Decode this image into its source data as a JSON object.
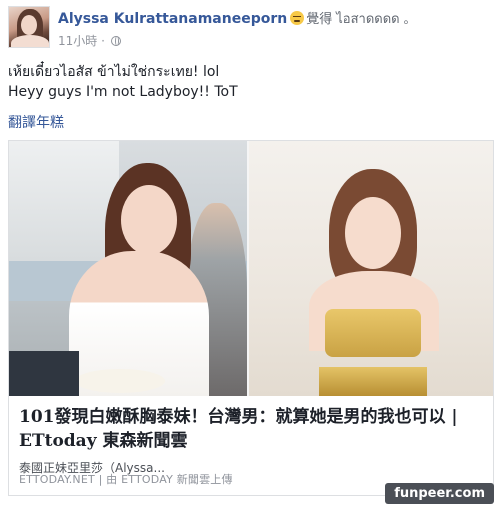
{
  "post": {
    "author_name": "Alyssa Kulrattanamaneeporn",
    "feeling_icon": "crying-face-emoji",
    "feeling_text": "覺得",
    "feeling_target": "ไอสาดดดด",
    "separator": "。",
    "timestamp": "11小時",
    "dot": "·",
    "privacy_icon": "globe-icon",
    "text_line_1": "เห้ยเดี๋ยวไอสัส ข้าไม่ใช่กระเทย! lol",
    "text_line_2": "Heyy guys I'm not Ladyboy!! ToT",
    "translate_label": "翻譯年糕"
  },
  "link_card": {
    "title": "101發現白嫩酥胸泰妹！台灣男：就算她是男的我也可以 | ETtoday 東森新聞雲",
    "description": "泰國正妹亞里莎（Alyssa...",
    "source": "ETTODAY.NET | 由 ETTODAY 新聞雲上傳"
  },
  "watermark": {
    "text": "funpeer.com"
  },
  "colors": {
    "link_blue": "#365899",
    "meta_gray": "#90949c",
    "border": "#dddfe2"
  }
}
